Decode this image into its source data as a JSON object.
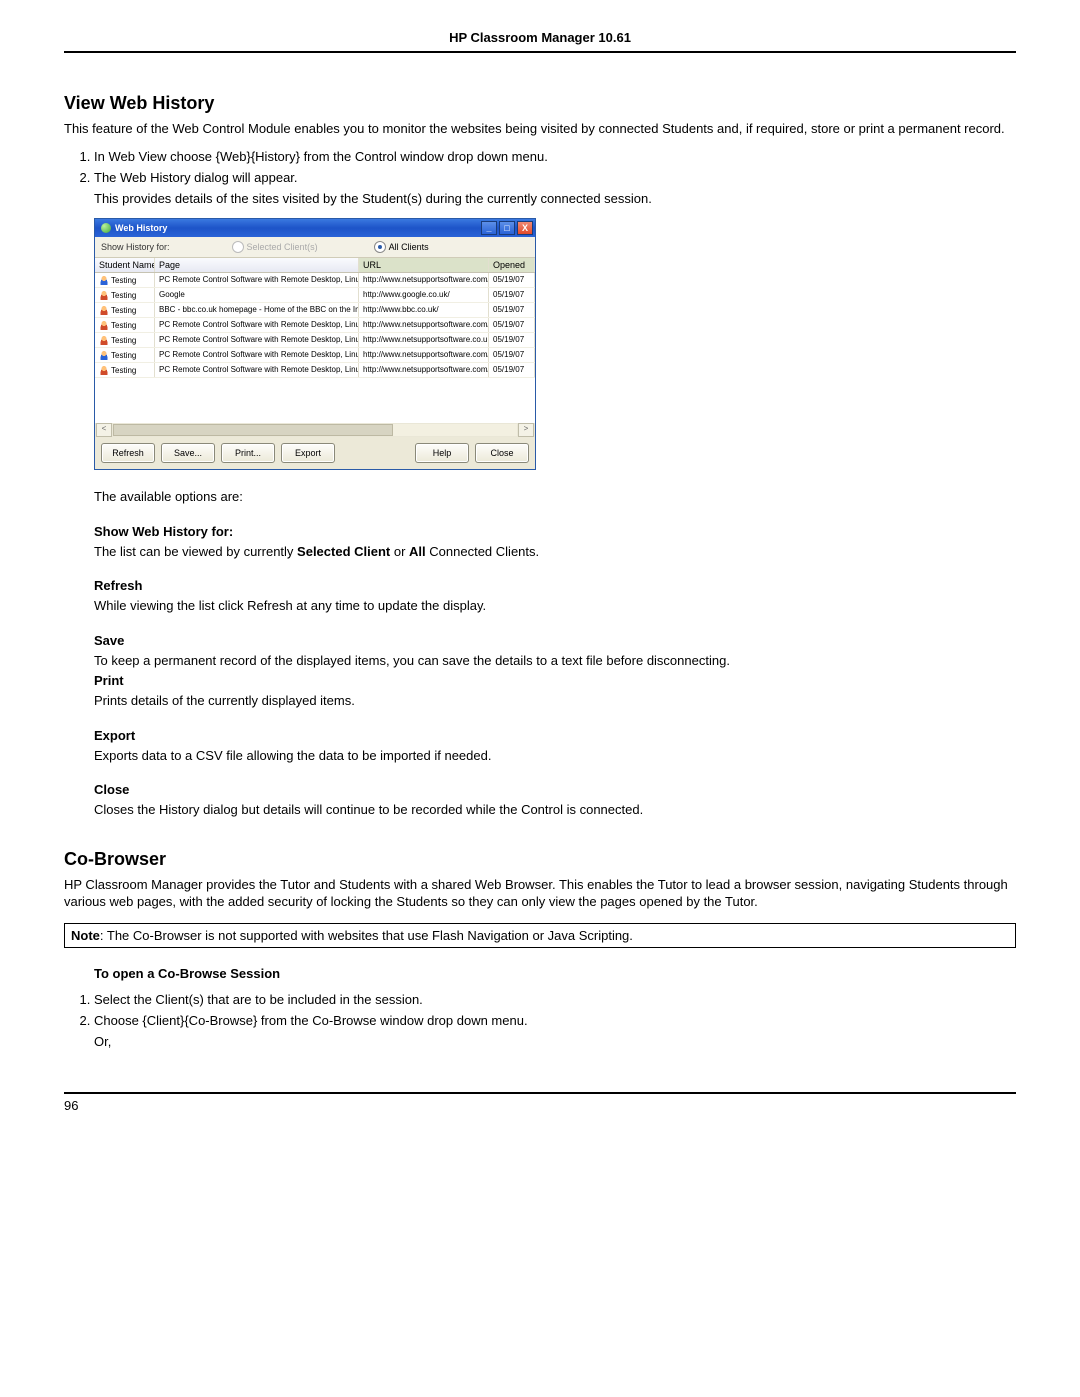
{
  "running_head": "HP Classroom Manager 10.61",
  "page_number": "96",
  "section1": {
    "title": "View Web History",
    "intro": "This feature of the Web Control Module enables you to monitor the websites being visited by connected Students and, if required, store or print a permanent record.",
    "steps": {
      "s1": "In Web View choose {Web}{History} from the Control window drop down menu.",
      "s2": "The Web History dialog will appear.",
      "s2_follow": "This provides details of the sites visited by the Student(s) during the currently connected session."
    }
  },
  "dialog": {
    "title": "Web History",
    "toolbar_label": "Show History for:",
    "radio_selected": "Selected Client(s)",
    "radio_all": "All Clients",
    "columns": {
      "c1": "Student Name",
      "c2": "Page",
      "c3": "URL",
      "c4": "Opened"
    },
    "rows": [
      {
        "name": "Testing",
        "page": "PC Remote Control Software with Remote Desktop, Linux and Pocket PC support.",
        "url": "http://www.netsupportsoftware.com/",
        "opened": "05/19/07",
        "icon": "blue"
      },
      {
        "name": "Testing",
        "page": "Google",
        "url": "http://www.google.co.uk/",
        "opened": "05/19/07",
        "icon": "red"
      },
      {
        "name": "Testing",
        "page": "BBC - bbc.co.uk homepage - Home of the BBC on the Internet",
        "url": "http://www.bbc.co.uk/",
        "opened": "05/19/07",
        "icon": "red"
      },
      {
        "name": "Testing",
        "page": "PC Remote Control Software with Remote Desktop, Linux and Pocket PC support.",
        "url": "http://www.netsupportsoftware.com/",
        "opened": "05/19/07",
        "icon": "red"
      },
      {
        "name": "Testing",
        "page": "PC Remote Control Software with Remote Desktop, Linux and Pocket PC support.",
        "url": "http://www.netsupportsoftware.co.uk/",
        "opened": "05/19/07",
        "icon": "red"
      },
      {
        "name": "Testing",
        "page": "PC Remote Control Software with Remote Desktop, Linux and Pocket PC support.",
        "url": "http://www.netsupportsoftware.com/",
        "opened": "05/19/07",
        "icon": "blue"
      },
      {
        "name": "Testing",
        "page": "PC Remote Control Software with Remote Desktop, Linux and Pocket PC support.",
        "url": "http://www.netsupportsoftware.com/",
        "opened": "05/19/07",
        "icon": "red"
      }
    ],
    "buttons": {
      "refresh": "Refresh",
      "save": "Save...",
      "print": "Print...",
      "export": "Export",
      "help": "Help",
      "close": "Close"
    }
  },
  "options": {
    "intro": "The available options are:",
    "show": {
      "head": "Show Web History for:",
      "body_pre": "The list can be viewed by currently ",
      "body_b1": "Selected Client",
      "body_mid": " or ",
      "body_b2": "All",
      "body_post": " Connected Clients."
    },
    "refresh": {
      "head": "Refresh",
      "body": "While viewing the list click Refresh at any time to update the display."
    },
    "save": {
      "head": "Save",
      "body": "To keep a permanent record of the displayed items, you can save the details to a text file before disconnecting."
    },
    "print": {
      "head": "Print",
      "body": "Prints details of the currently displayed items."
    },
    "export": {
      "head": "Export",
      "body": "Exports data to a CSV file allowing the data to be imported if needed."
    },
    "close": {
      "head": "Close",
      "body": "Closes the History dialog but details will continue to be recorded while the Control is connected."
    }
  },
  "section2": {
    "title": "Co-Browser",
    "intro": "HP Classroom Manager provides the Tutor and Students with a shared Web Browser. This enables the Tutor to lead a browser session, navigating Students through various web pages, with the added security of locking the Students so they can only view the pages opened by the Tutor.",
    "note_b": "Note",
    "note_body": ": The Co-Browser is not supported with websites that use Flash Navigation or Java Scripting.",
    "open_head": "To open a Co-Browse Session",
    "steps": {
      "s1": "Select the Client(s) that are to be included in the session.",
      "s2": "Choose {Client}{Co-Browse} from the Co-Browse window drop down menu.",
      "s2_or": "Or,"
    }
  }
}
